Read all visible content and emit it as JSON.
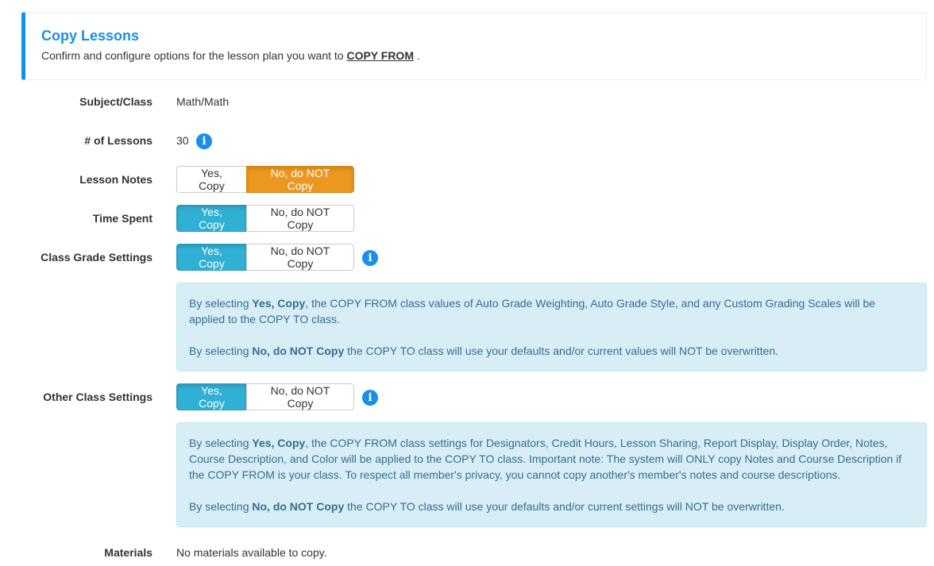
{
  "header": {
    "title": "Copy Lessons",
    "subtitle_prefix": "Confirm and configure options for the lesson plan you want to ",
    "subtitle_emphasis": "COPY FROM",
    "subtitle_suffix": " ."
  },
  "colors": {
    "accent": "#1a8ee8",
    "selected_yes": "#31b0d5",
    "selected_no": "#ec971f",
    "info_bg": "#d9edf7",
    "info_text": "#31708f"
  },
  "fields": {
    "subject_class": {
      "label": "Subject/Class",
      "value": "Math/Math"
    },
    "num_lessons": {
      "label": "# of Lessons",
      "value": "30",
      "icon": "info-icon"
    },
    "lesson_notes": {
      "label": "Lesson Notes",
      "yes_label": "Yes, Copy",
      "no_label": "No, do NOT Copy",
      "selected": "no"
    },
    "time_spent": {
      "label": "Time Spent",
      "yes_label": "Yes, Copy",
      "no_label": "No, do NOT Copy",
      "selected": "yes"
    },
    "class_grade_settings": {
      "label": "Class Grade Settings",
      "yes_label": "Yes, Copy",
      "no_label": "No, do NOT Copy",
      "selected": "yes",
      "icon": "info-icon",
      "info": {
        "p1_prefix": "By selecting ",
        "p1_bold": "Yes, Copy",
        "p1_text": ", the COPY FROM class values of Auto Grade Weighting, Auto Grade Style, and any Custom Grading Scales will be applied to the COPY TO class.",
        "p2_prefix": "By selecting ",
        "p2_bold": "No, do NOT Copy",
        "p2_text": " the COPY TO class will use your defaults and/or current values will NOT be overwritten."
      }
    },
    "other_class_settings": {
      "label": "Other Class Settings",
      "yes_label": "Yes, Copy",
      "no_label": "No, do NOT Copy",
      "selected": "yes",
      "icon": "info-icon",
      "info": {
        "p1_prefix": "By selecting ",
        "p1_bold": "Yes, Copy",
        "p1_text": ", the COPY FROM class settings for Designators, Credit Hours, Lesson Sharing, Report Display, Display Order, Notes, Course Description, and Color will be applied to the COPY TO class. Important note: The system will ONLY copy Notes and Course Description if the COPY FROM is your class. To respect all member's privacy, you cannot copy another's member's notes and course descriptions.",
        "p2_prefix": "By selecting ",
        "p2_bold": "No, do NOT Copy",
        "p2_text": " the COPY TO class will use your defaults and/or current settings will NOT be overwritten."
      }
    },
    "materials": {
      "label": "Materials",
      "value": "No materials available to copy."
    }
  }
}
